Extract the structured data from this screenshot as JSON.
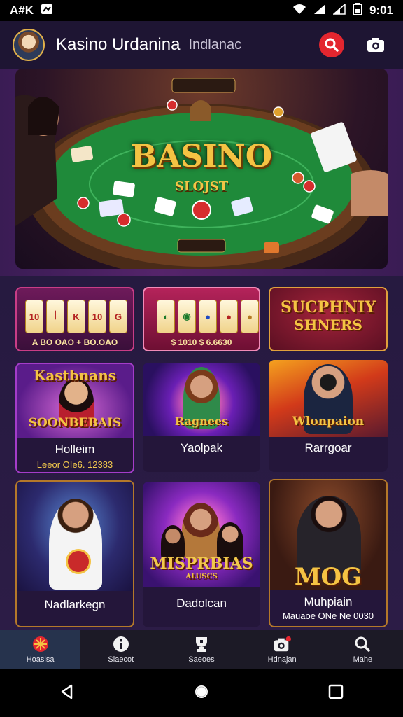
{
  "status_bar": {
    "carrier": "A#K",
    "time": "9:01"
  },
  "header": {
    "title": "Kasino Urdanina",
    "subtitle": "Indlanac"
  },
  "hero": {
    "title": "BASINO",
    "subtitle": "SLOJST"
  },
  "games": [
    {
      "id": "slot-1",
      "caption": "A BO  OAO  + BO.OAO"
    },
    {
      "id": "slot-2",
      "caption": "$ 1010   $ 6.6630"
    },
    {
      "id": "slot-3",
      "art_text_1": "SUCPHNIY",
      "art_text_2": "SHNERS"
    },
    {
      "id": "game-4",
      "art_text_1": "Kastbnans",
      "art_text_2": "SOONBEBAIS",
      "label": "Holleim",
      "sublabel": "Leeor OIe6. 12383"
    },
    {
      "id": "game-5",
      "art_text_1": "Ragnees",
      "label": "Yaolpak"
    },
    {
      "id": "game-6",
      "art_text_1": "Wlonpaion",
      "label": "Rarrgoar"
    },
    {
      "id": "game-7",
      "label": "Nadlarkegn"
    },
    {
      "id": "game-8",
      "art_text_1": "MISPRBIAS",
      "art_text_2": "ALUSCS",
      "label": "Dadolcan"
    },
    {
      "id": "game-9",
      "art_text_1": "MOG",
      "label": "Muhpiain",
      "sublabel": "Mauaoe ONe Ne 0030"
    }
  ],
  "bottom_nav": [
    {
      "label": "Hoasisa",
      "icon": "casino-chip-icon",
      "active": true
    },
    {
      "label": "Slaecot",
      "icon": "info-icon",
      "active": false
    },
    {
      "label": "Saeoes",
      "icon": "trophy-icon",
      "active": false
    },
    {
      "label": "Hdnajan",
      "icon": "camera-icon",
      "active": false
    },
    {
      "label": "Mahe",
      "icon": "search-icon",
      "active": false
    }
  ],
  "colors": {
    "accent_red": "#e3262f",
    "gold": "#f4c343",
    "header_bg": "#1e1533"
  }
}
